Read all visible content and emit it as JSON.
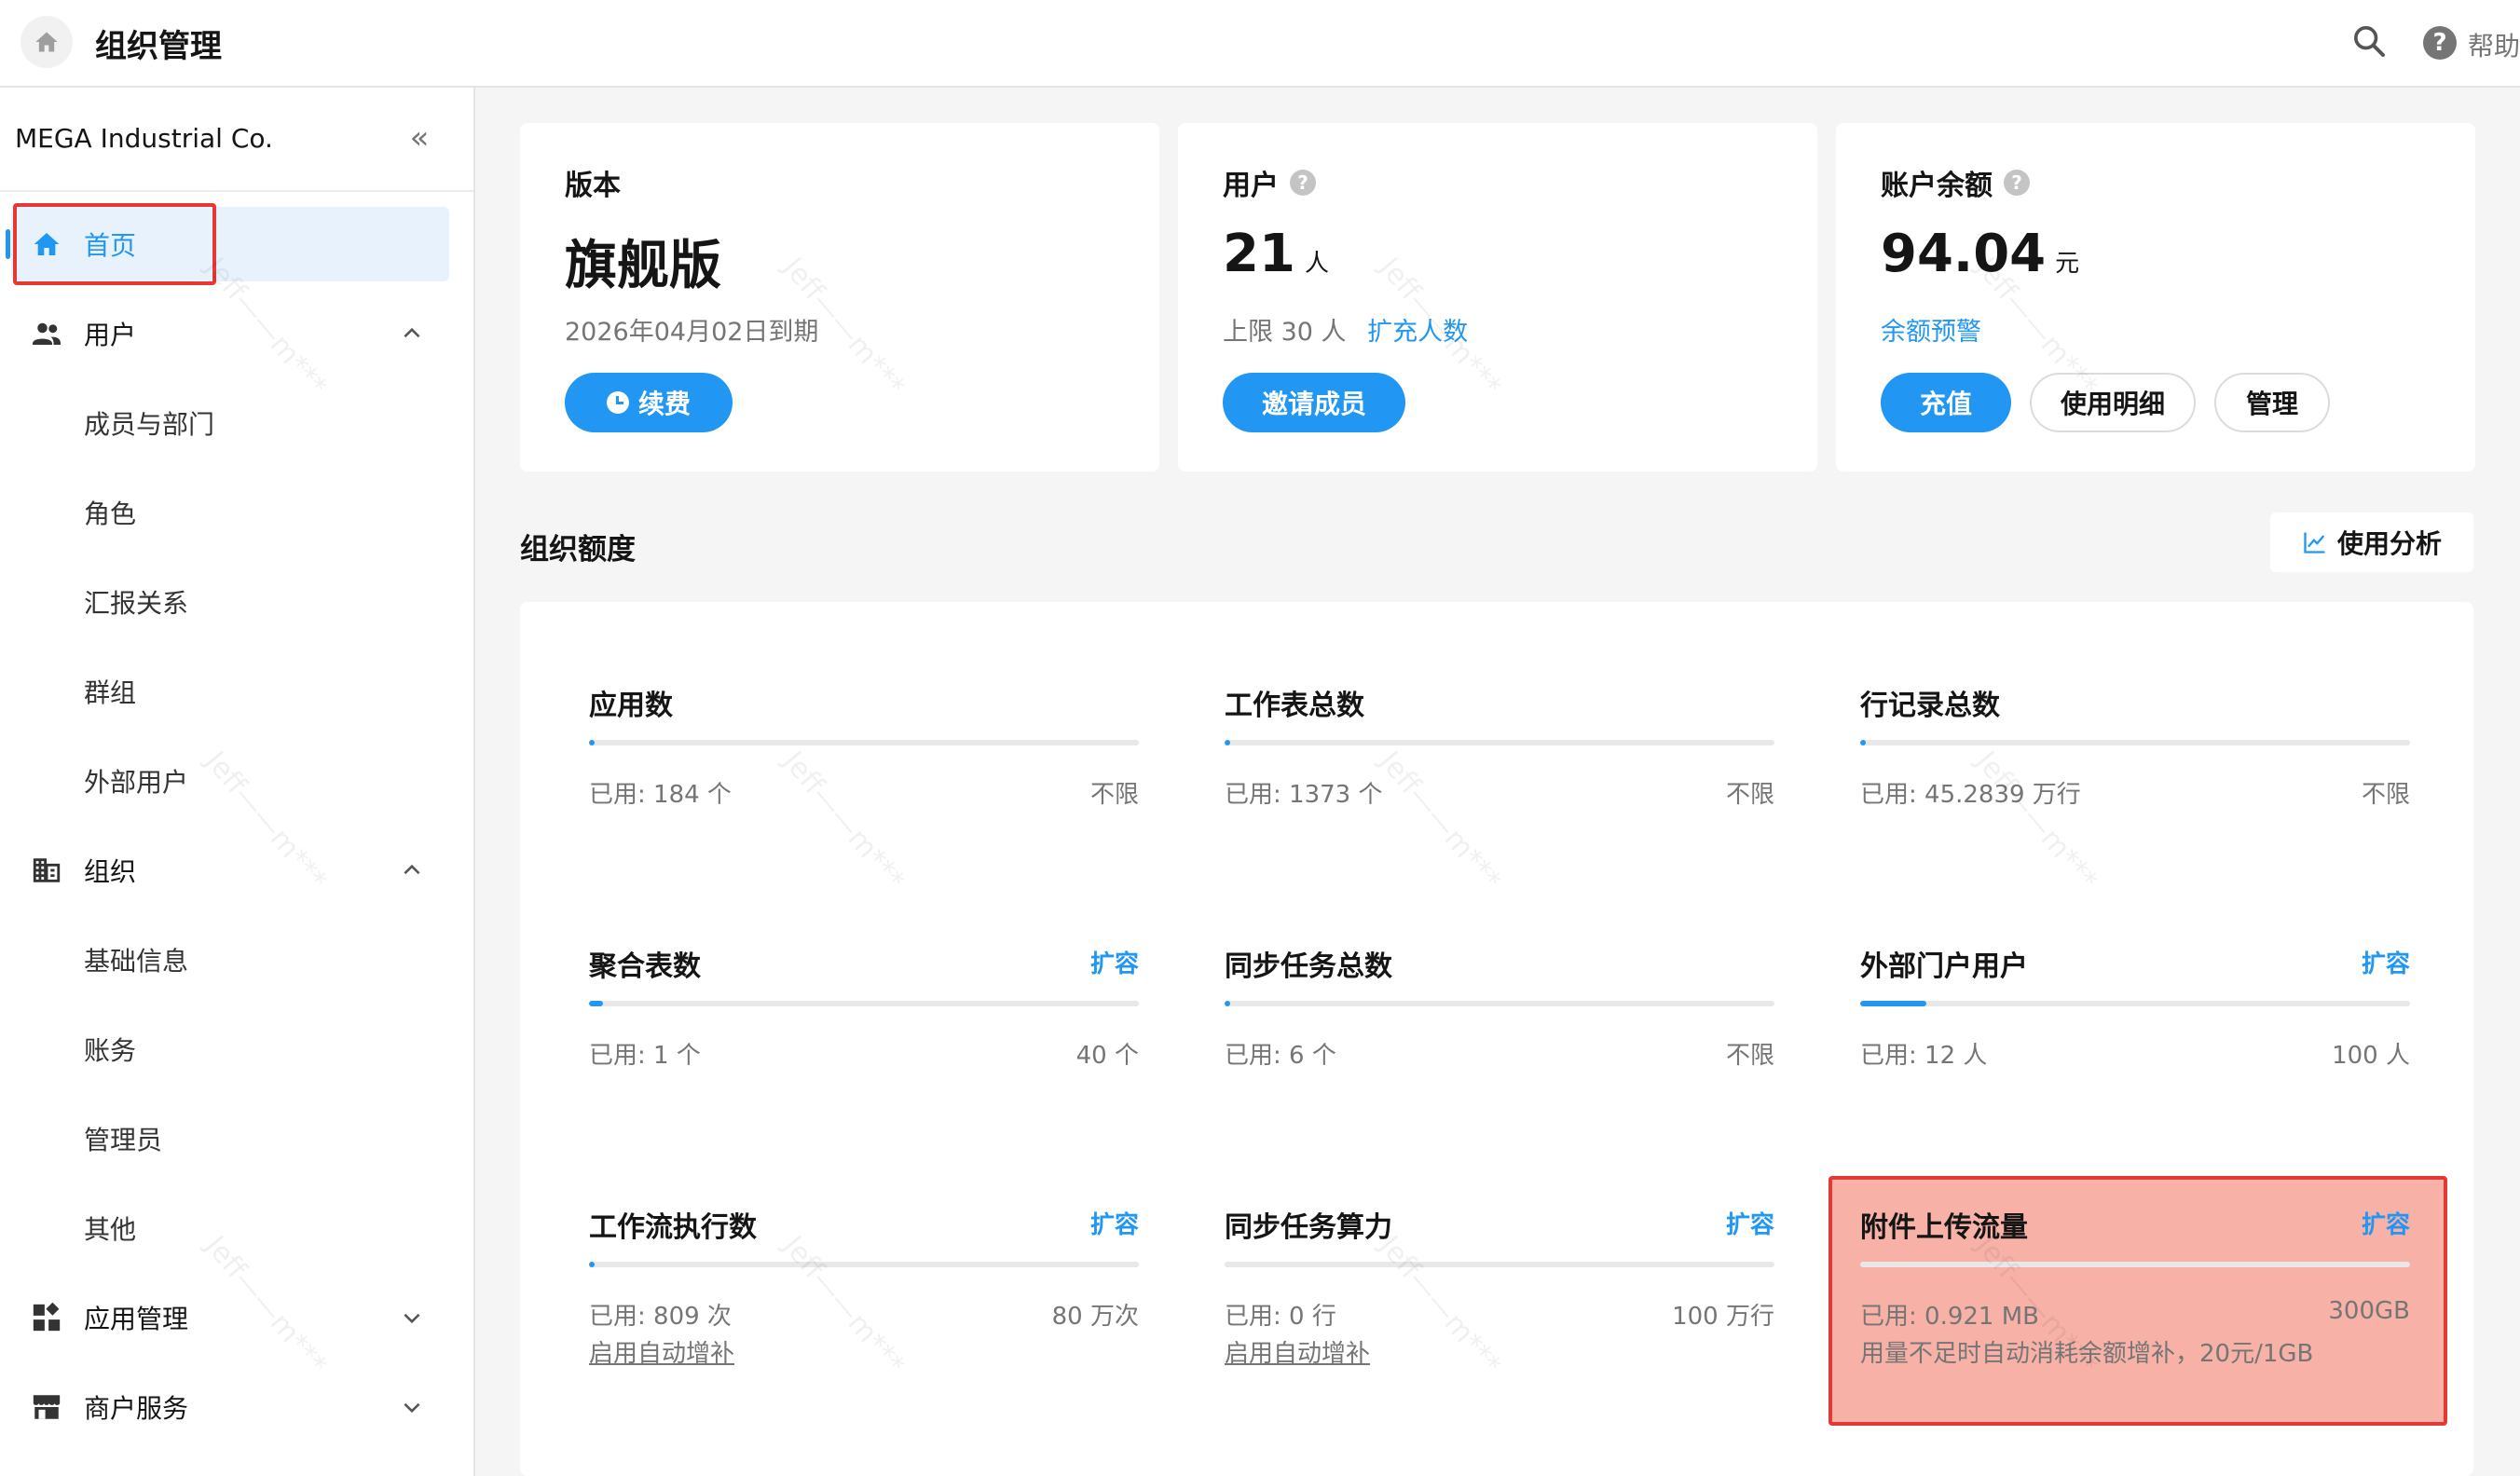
{
  "topbar": {
    "title": "组织管理",
    "help_label": "帮助"
  },
  "sidebar": {
    "org_name": "MEGA Industrial Co.",
    "items": [
      {
        "label": "首页",
        "icon": "home-icon",
        "active": true
      },
      {
        "label": "用户",
        "icon": "users-icon",
        "expanded": true
      },
      {
        "label": "成员与部门"
      },
      {
        "label": "角色"
      },
      {
        "label": "汇报关系"
      },
      {
        "label": "群组"
      },
      {
        "label": "外部用户"
      },
      {
        "label": "组织",
        "icon": "building-icon",
        "expanded": true
      },
      {
        "label": "基础信息"
      },
      {
        "label": "账务"
      },
      {
        "label": "管理员"
      },
      {
        "label": "其他"
      },
      {
        "label": "应用管理",
        "icon": "apps-icon",
        "expanded": false
      },
      {
        "label": "商户服务",
        "icon": "store-icon",
        "expanded": false
      }
    ]
  },
  "cards": {
    "edition": {
      "title": "版本",
      "value": "旗舰版",
      "expiry": "2026年04月02日到期",
      "renew_label": "续费"
    },
    "users": {
      "title": "用户",
      "value": "21",
      "unit": "人",
      "limit_text": "上限 30 人",
      "expand_link": "扩充人数",
      "invite_label": "邀请成员"
    },
    "balance": {
      "title": "账户余额",
      "value": "94.04",
      "unit": "元",
      "alert_link": "余额预警",
      "recharge_label": "充值",
      "details_label": "使用明细",
      "manage_label": "管理"
    }
  },
  "quota_section": {
    "title": "组织额度",
    "analysis_label": "使用分析",
    "items": [
      {
        "name": "应用数",
        "used": "已用: 184 个",
        "limit": "不限",
        "expand": "",
        "progress": 0.01
      },
      {
        "name": "工作表总数",
        "used": "已用: 1373 个",
        "limit": "不限",
        "expand": "",
        "progress": 0.01
      },
      {
        "name": "行记录总数",
        "used": "已用: 45.2839 万行",
        "limit": "不限",
        "expand": "",
        "progress": 0.01
      },
      {
        "name": "聚合表数",
        "used": "已用: 1 个",
        "limit": "40 个",
        "expand": "扩容",
        "progress": 0.025
      },
      {
        "name": "同步任务总数",
        "used": "已用: 6 个",
        "limit": "不限",
        "expand": "",
        "progress": 0.01
      },
      {
        "name": "外部门户用户",
        "used": "已用: 12 人",
        "limit": "100 人",
        "expand": "扩容",
        "progress": 0.12
      },
      {
        "name": "工作流执行数",
        "used": "已用: 809 次",
        "limit": "80 万次",
        "expand": "扩容",
        "progress": 0.001,
        "auto": "启用自动增补"
      },
      {
        "name": "同步任务算力",
        "used": "已用: 0 行",
        "limit": "100 万行",
        "expand": "扩容",
        "progress": 0.0,
        "auto": "启用自动增补"
      },
      {
        "name": "附件上传流量",
        "used": "已用: 0.921 MB",
        "limit": "300GB",
        "expand": "扩容",
        "progress": 0.0,
        "note": "用量不足时自动消耗余额增补，20元/1GB"
      }
    ]
  },
  "watermark": "Jeff——m***",
  "colors": {
    "accent": "#2196f3",
    "highlight": "#e53935"
  }
}
